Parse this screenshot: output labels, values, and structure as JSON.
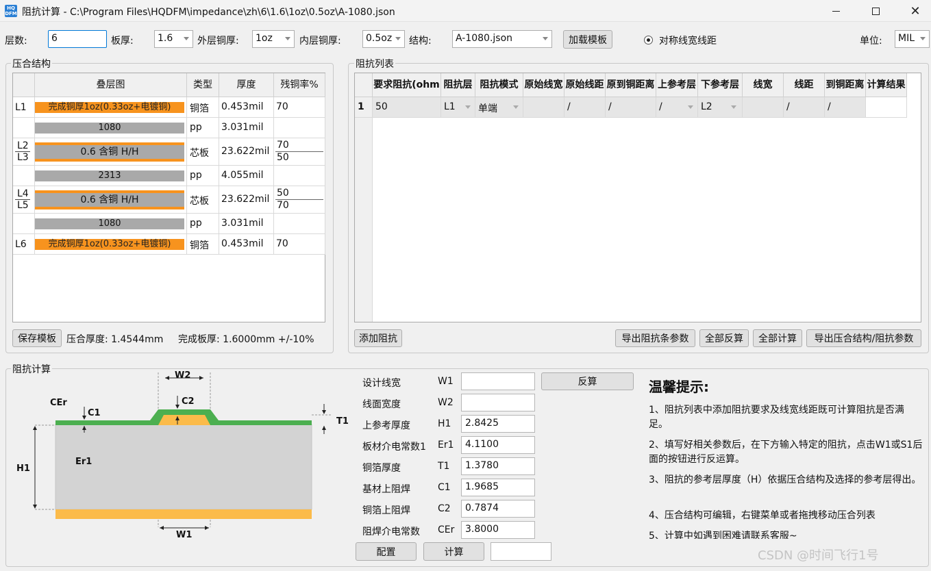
{
  "window": {
    "title": "阻抗计算 - C:\\Program Files\\HQDFM\\impedance\\zh\\6\\1.6\\1oz\\0.5oz\\A-1080.json",
    "logo": "HQ DFM"
  },
  "toolbar": {
    "layers_label": "层数:",
    "layers_value": "6",
    "thickness_label": "板厚:",
    "thickness_value": "1.6",
    "outer_cu_label": "外层铜厚:",
    "outer_cu_value": "1oz",
    "inner_cu_label": "内层铜厚:",
    "inner_cu_value": "0.5oz",
    "structure_label": "结构:",
    "structure_value": "A-1080.json",
    "load_template": "加载模板",
    "symmetric": "对称线宽线距",
    "unit_label": "单位:",
    "unit_value": "MIL"
  },
  "stackup": {
    "title": "压合结构",
    "headers": [
      "叠层图",
      "类型",
      "厚度",
      "残铜率%"
    ],
    "rows": [
      {
        "layer": "L1",
        "bar": "完成铜厚1oz(0.33oz+电镀铜)",
        "type": "铜箔",
        "thickness": "0.453mil",
        "rate": "70"
      },
      {
        "layer": "",
        "bar": "1080",
        "type": "pp",
        "thickness": "3.031mil",
        "rate": ""
      },
      {
        "layer_a": "L2",
        "layer_b": "L3",
        "bar": "0.6 含铜 H/H",
        "type": "芯板",
        "thickness": "23.622mil",
        "rate_a": "70",
        "rate_b": "50"
      },
      {
        "layer": "",
        "bar": "2313",
        "type": "pp",
        "thickness": "4.055mil",
        "rate": ""
      },
      {
        "layer_a": "L4",
        "layer_b": "L5",
        "bar": "0.6 含铜 H/H",
        "type": "芯板",
        "thickness": "23.622mil",
        "rate_a": "50",
        "rate_b": "70"
      },
      {
        "layer": "",
        "bar": "1080",
        "type": "pp",
        "thickness": "3.031mil",
        "rate": ""
      },
      {
        "layer": "L6",
        "bar": "完成铜厚1oz(0.33oz+电镀铜)",
        "type": "铜箔",
        "thickness": "0.453mil",
        "rate": "70"
      }
    ],
    "save_template": "保存模板",
    "press_thickness": "压合厚度:   1.4544mm",
    "finished_thickness": "完成板厚:   1.6000mm +/-10%"
  },
  "impedance_list": {
    "title": "阻抗列表",
    "headers": [
      "要求阻抗(ohm",
      "阻抗层",
      "阻抗模式",
      "原始线宽",
      "原始线距",
      "原到铜距离",
      "上参考层",
      "下参考层",
      "线宽",
      "线距",
      "到铜距离",
      "计算结果"
    ],
    "row": {
      "index": "1",
      "impedance": "50",
      "layer": "L1",
      "mode": "单端",
      "orig_width": "",
      "orig_space": "/",
      "orig_copper": "/",
      "upper_ref": "/",
      "lower_ref": "L2",
      "width": "",
      "space": "/",
      "copper": "/",
      "result": ""
    },
    "add": "添加阻抗",
    "export_params": "导出阻抗条参数",
    "reverse_all": "全部反算",
    "calc_all": "全部计算",
    "export_all": "导出压合结构/阻抗参数"
  },
  "calc": {
    "title": "阻抗计算",
    "diagram": {
      "w2": "W2",
      "c2": "C2",
      "cer": "CEr",
      "c1": "C1",
      "t1": "T1",
      "h1": "H1",
      "er1": "Er1",
      "w1": "W1"
    },
    "fields": [
      {
        "label": "设计线宽",
        "sym": "W1",
        "value": ""
      },
      {
        "label": "线面宽度",
        "sym": "W2",
        "value": ""
      },
      {
        "label": "上参考厚度",
        "sym": "H1",
        "value": "2.8425"
      },
      {
        "label": "板材介电常数1",
        "sym": "Er1",
        "value": "4.1100"
      },
      {
        "label": "铜箔厚度",
        "sym": "T1",
        "value": "1.3780"
      },
      {
        "label": "基材上阻焊",
        "sym": "C1",
        "value": "1.9685"
      },
      {
        "label": "铜箔上阻焊",
        "sym": "C2",
        "value": "0.7874"
      },
      {
        "label": "阻焊介电常数",
        "sym": "CEr",
        "value": "3.8000"
      }
    ],
    "reverse": "反算",
    "config": "配置",
    "compute": "计算",
    "result": ""
  },
  "tips": {
    "title": "温馨提示:",
    "items": [
      "1、阻抗列表中添加阻抗要求及线宽线距既可计算阻抗是否满足。",
      "2、填写好相关参数后，在下方输入特定的阻抗，点击W1或S1后面的按钮进行反运算。",
      "3、阻抗的参考层厚度（H）依据压合结构及选择的参考层得出。",
      "4、压合结构可编辑，右键菜单或者拖拽移动压合列表",
      "5、计算中如遇到困难请联系客服~"
    ]
  },
  "watermark": "CSDN @时间飞行1号"
}
